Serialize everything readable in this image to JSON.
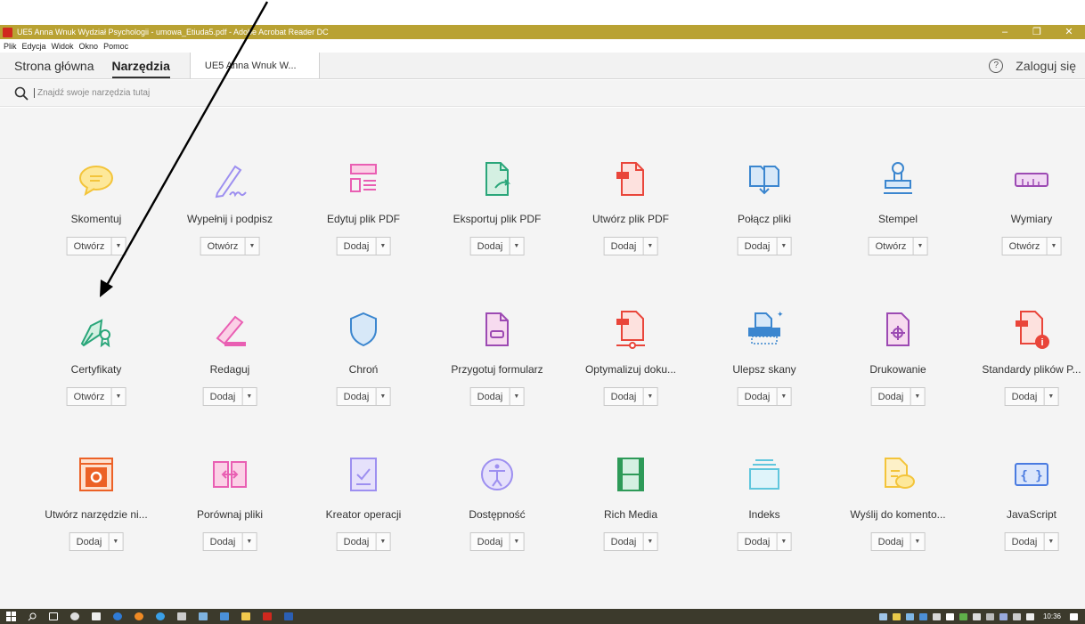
{
  "window": {
    "title": "UE5 Anna Wnuk Wydział Psychologii - umowa_Etiuda5.pdf - Adobe Acrobat Reader DC",
    "minimize": "–",
    "maximize": "❐",
    "close": "✕"
  },
  "menu": [
    "Plik",
    "Edycja",
    "Widok",
    "Okno",
    "Pomoc"
  ],
  "tabs": {
    "home": "Strona główna",
    "tools": "Narzędzia",
    "document": "UE5 Anna Wnuk W...",
    "help_glyph": "?",
    "signin": "Zaloguj się"
  },
  "search": {
    "placeholder": "Znajdź swoje narzędzia tutaj"
  },
  "tools": [
    {
      "name": "Skomentuj",
      "action": "Otwórz",
      "icon": "comment-icon"
    },
    {
      "name": "Wypełnij i podpisz",
      "action": "Otwórz",
      "icon": "fill-sign-icon"
    },
    {
      "name": "Edytuj plik PDF",
      "action": "Dodaj",
      "icon": "edit-pdf-icon"
    },
    {
      "name": "Eksportuj plik PDF",
      "action": "Dodaj",
      "icon": "export-pdf-icon"
    },
    {
      "name": "Utwórz plik PDF",
      "action": "Dodaj",
      "icon": "create-pdf-icon"
    },
    {
      "name": "Połącz pliki",
      "action": "Dodaj",
      "icon": "combine-files-icon"
    },
    {
      "name": "Stempel",
      "action": "Otwórz",
      "icon": "stamp-icon"
    },
    {
      "name": "Wymiary",
      "action": "Otwórz",
      "icon": "ruler-icon"
    },
    {
      "name": "Certyfikaty",
      "action": "Otwórz",
      "icon": "certificate-pen-icon"
    },
    {
      "name": "Redaguj",
      "action": "Dodaj",
      "icon": "redact-icon"
    },
    {
      "name": "Chroń",
      "action": "Dodaj",
      "icon": "shield-icon"
    },
    {
      "name": "Przygotuj formularz",
      "action": "Dodaj",
      "icon": "prepare-form-icon"
    },
    {
      "name": "Optymalizuj doku...",
      "action": "Dodaj",
      "icon": "optimize-pdf-icon"
    },
    {
      "name": "Ulepsz skany",
      "action": "Dodaj",
      "icon": "enhance-scan-icon"
    },
    {
      "name": "Drukowanie",
      "action": "Dodaj",
      "icon": "print-production-icon"
    },
    {
      "name": "Standardy plików P...",
      "action": "Dodaj",
      "icon": "pdf-standards-icon"
    },
    {
      "name": "Utwórz narzędzie ni...",
      "action": "Dodaj",
      "icon": "custom-tool-icon"
    },
    {
      "name": "Porównaj pliki",
      "action": "Dodaj",
      "icon": "compare-files-icon"
    },
    {
      "name": "Kreator operacji",
      "action": "Dodaj",
      "icon": "action-wizard-icon"
    },
    {
      "name": "Dostępność",
      "action": "Dodaj",
      "icon": "accessibility-icon"
    },
    {
      "name": "Rich Media",
      "action": "Dodaj",
      "icon": "rich-media-icon"
    },
    {
      "name": "Indeks",
      "action": "Dodaj",
      "icon": "index-icon"
    },
    {
      "name": "Wyślij do komento...",
      "action": "Dodaj",
      "icon": "send-comments-icon"
    },
    {
      "name": "JavaScript",
      "action": "Dodaj",
      "icon": "javascript-icon"
    }
  ],
  "dropdown_glyph": "▼",
  "taskbar": {
    "clock": "10:36"
  },
  "colors": {
    "titlebar": "#b9a233",
    "taskbar": "#3c3a2c",
    "comment": "#f3c43a",
    "purple": "#9d8ff0",
    "pink": "#e95fb3",
    "teal": "#2aa67a",
    "red": "#e9453a",
    "blue": "#3b86cf",
    "violet": "#9c4ab3",
    "orange": "#ec6126",
    "green": "#2d9a58",
    "lightblue": "#5fc6dd",
    "indigo": "#4a7be0"
  }
}
